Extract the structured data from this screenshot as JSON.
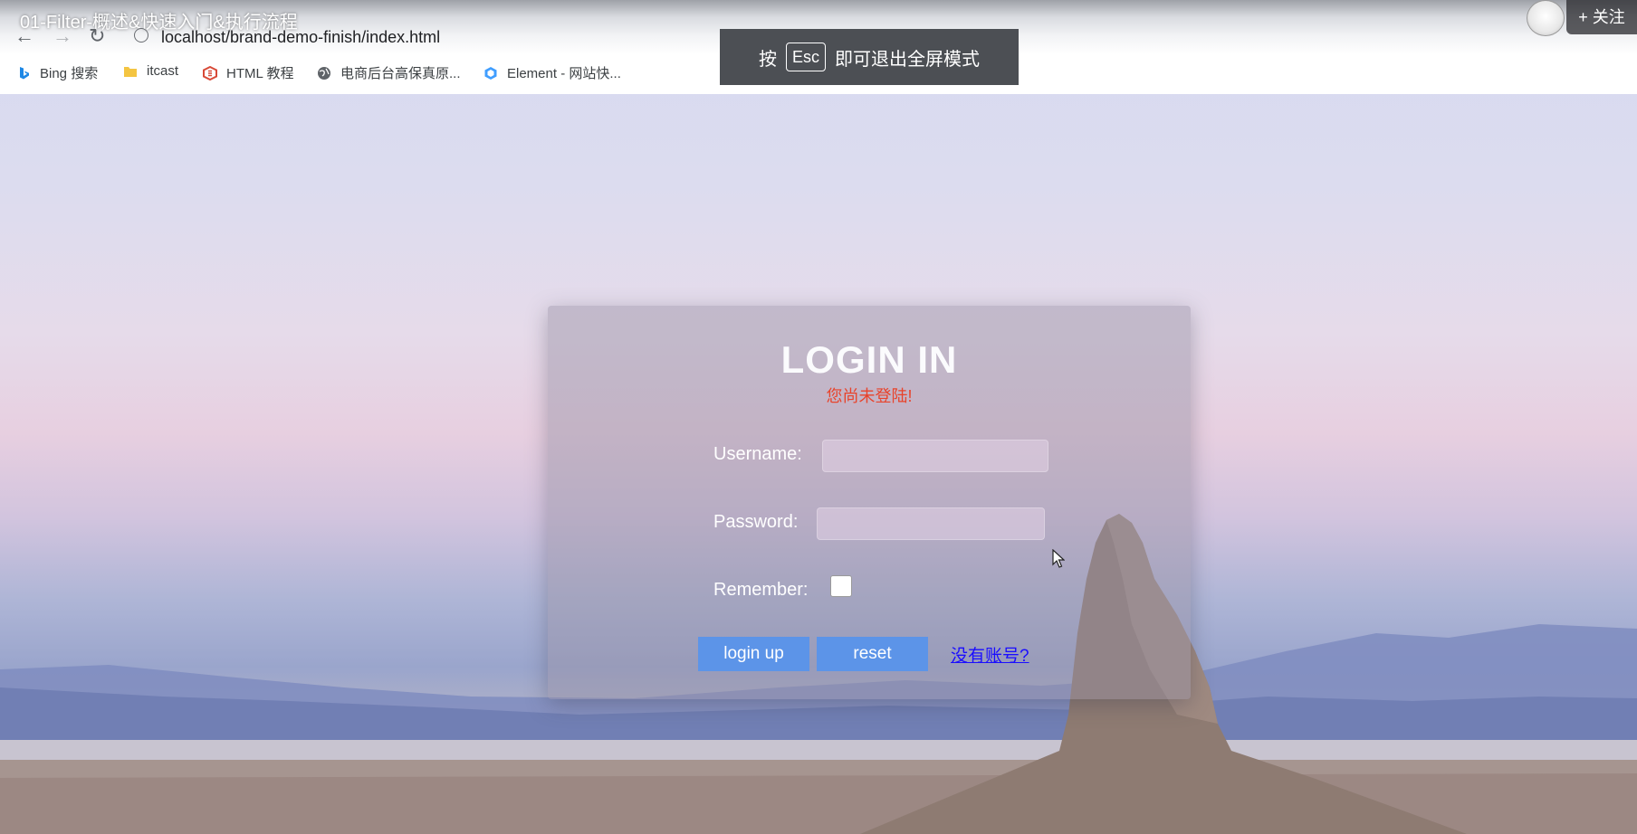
{
  "video_title": "01-Filter-概述&快速入门&执行流程",
  "address_bar": {
    "url": "localhost/brand-demo-finish/index.html"
  },
  "bookmarks": [
    {
      "label": "Bing 搜索",
      "icon": "bing-icon"
    },
    {
      "label": "itcast",
      "icon": "folder-icon"
    },
    {
      "label": "HTML 教程",
      "icon": "html-icon"
    },
    {
      "label": "电商后台高保真原...",
      "icon": "globe-icon"
    },
    {
      "label": "Element - 网站快...",
      "icon": "element-icon"
    }
  ],
  "fullscreen_toast": {
    "prefix": "按",
    "key": "Esc",
    "suffix": "即可退出全屏模式"
  },
  "follow_button": {
    "label": "+ 关注"
  },
  "login": {
    "title": "LOGIN IN",
    "error_message": "您尚未登陆!",
    "username_label": "Username:",
    "username_value": "",
    "password_label": "Password:",
    "password_value": "",
    "remember_label": "Remember:",
    "remember_checked": false,
    "login_button": "login up",
    "reset_button": "reset",
    "register_link": "没有账号?"
  },
  "colors": {
    "button": "#5c94e8",
    "error": "#e8432b",
    "link": "#1a0dff",
    "toast_bg": "#4c4f54"
  }
}
